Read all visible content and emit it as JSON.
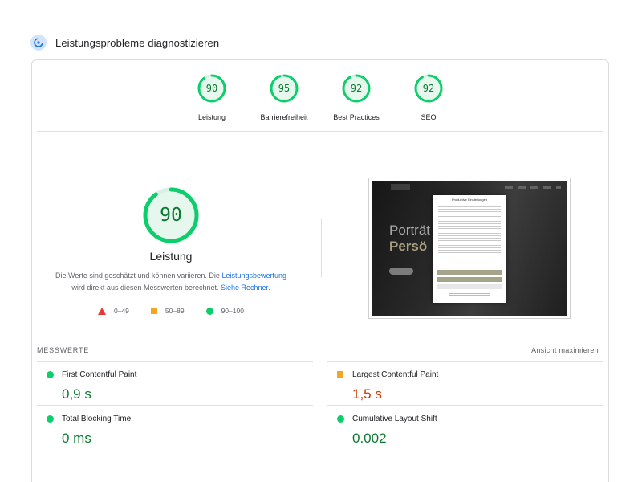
{
  "header": {
    "title": "Leistungsprobleme diagnostizieren",
    "icon": "gauge-icon"
  },
  "gauges": [
    {
      "score": "90",
      "label": "Leistung",
      "level": 0.9
    },
    {
      "score": "95",
      "label": "Barrierefreiheit",
      "level": 0.95
    },
    {
      "score": "92",
      "label": "Best Practices",
      "level": 0.92
    },
    {
      "score": "92",
      "label": "SEO",
      "level": 0.92
    }
  ],
  "main": {
    "score": "90",
    "level": 0.9,
    "label": "Leistung",
    "desc_part1": "Die Werte sind geschätzt und können variieren. Die ",
    "link1": "Leistungsbewertung",
    "desc_part2": "wird direkt aus diesen Messwerten berechnet. ",
    "link2": "Siehe Rechner",
    "desc_part3": "."
  },
  "legend": [
    {
      "shape": "triangle",
      "range": "0–49",
      "color": "#e53935"
    },
    {
      "shape": "square",
      "range": "50–89",
      "color": "#f4a622"
    },
    {
      "shape": "circle",
      "range": "90–100",
      "color": "#0cce6b"
    }
  ],
  "screenshot": {
    "headline1": "Porträt",
    "headline2": "Persö",
    "dialog_title": "Produktive Einstellungen"
  },
  "metrics_section": {
    "title": "MESSWERTE",
    "expand": "Ansicht maximieren"
  },
  "metrics": [
    {
      "name": "First Contentful Paint",
      "value": "0,9 s",
      "status": "good"
    },
    {
      "name": "Largest Contentful Paint",
      "value": "1,5 s",
      "status": "average"
    },
    {
      "name": "Total Blocking Time",
      "value": "0 ms",
      "status": "good"
    },
    {
      "name": "Cumulative Layout Shift",
      "value": "0.002",
      "status": "good"
    }
  ],
  "colors": {
    "good": "#0cce6b",
    "good_text": "#0c7a31",
    "average": "#f4a622",
    "average_text": "#c33300",
    "poor": "#e53935",
    "link": "#1a73e8"
  }
}
